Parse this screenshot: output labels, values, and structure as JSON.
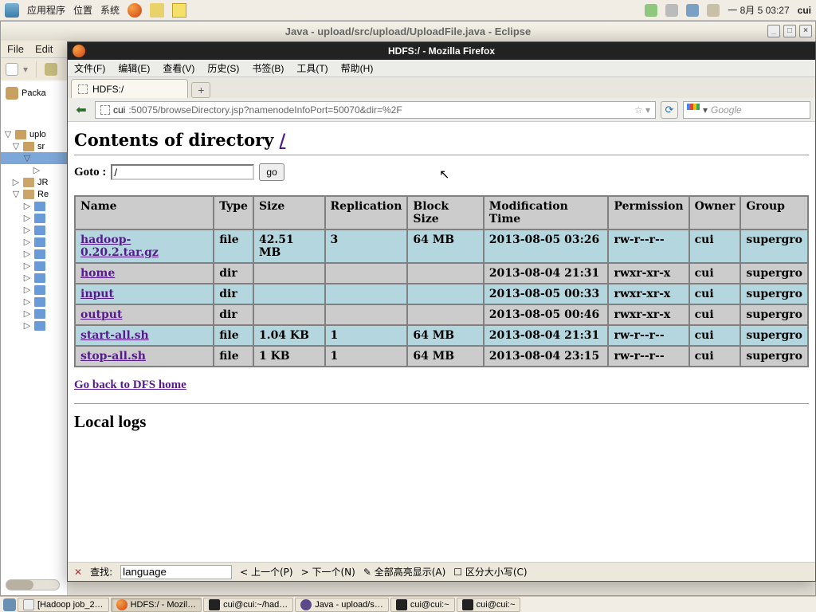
{
  "gnome": {
    "apps": "应用程序",
    "places": "位置",
    "system": "系统",
    "date": "一 8月  5 03:27",
    "user": "cui"
  },
  "eclipse": {
    "title": "Java - upload/src/upload/UploadFile.java - Eclipse",
    "menu_file": "File",
    "menu_edit": "Edit",
    "pkg_explorer": "Packa",
    "nodes": {
      "uplo": "uplo",
      "sr": "sr",
      "jr": "JR",
      "re": "Re"
    }
  },
  "firefox": {
    "title": "HDFS:/ - Mozilla Firefox",
    "menu": {
      "file": "文件(F)",
      "edit": "编辑(E)",
      "view": "查看(V)",
      "history": "历史(S)",
      "bookmarks": "书签(B)",
      "tools": "工具(T)",
      "help": "帮助(H)"
    },
    "tab": "HDFS:/",
    "url_host": "cui",
    "url_path": ":50075/browseDirectory.jsp?namenodeInfoPort=50070&dir=%2F",
    "search_placeholder": "Google"
  },
  "page": {
    "heading_pre": "Contents of directory ",
    "heading_link": "/",
    "goto_label": "Goto : ",
    "goto_value": "/",
    "go_btn": "go",
    "headers": {
      "name": "Name",
      "type": "Type",
      "size": "Size",
      "repl": "Replication",
      "bs": "Block Size",
      "mtime": "Modification Time",
      "perm": "Permission",
      "owner": "Owner",
      "group": "Group"
    },
    "rows": [
      {
        "cls": "filerow",
        "name": "hadoop-0.20.2.tar.gz",
        "type": "file",
        "size": "42.51 MB",
        "repl": "3",
        "bs": "64 MB",
        "mtime": "2013-08-05 03:26",
        "perm": "rw-r--r--",
        "owner": "cui",
        "group": "supergro"
      },
      {
        "cls": "",
        "name": "home",
        "type": "dir",
        "size": "",
        "repl": "",
        "bs": "",
        "mtime": "2013-08-04 21:31",
        "perm": "rwxr-xr-x",
        "owner": "cui",
        "group": "supergro"
      },
      {
        "cls": "filerow",
        "name": "input",
        "type": "dir",
        "size": "",
        "repl": "",
        "bs": "",
        "mtime": "2013-08-05 00:33",
        "perm": "rwxr-xr-x",
        "owner": "cui",
        "group": "supergro"
      },
      {
        "cls": "",
        "name": "output",
        "type": "dir",
        "size": "",
        "repl": "",
        "bs": "",
        "mtime": "2013-08-05 00:46",
        "perm": "rwxr-xr-x",
        "owner": "cui",
        "group": "supergro"
      },
      {
        "cls": "filerow",
        "name": "start-all.sh",
        "type": "file",
        "size": "1.04 KB",
        "repl": "1",
        "bs": "64 MB",
        "mtime": "2013-08-04 21:31",
        "perm": "rw-r--r--",
        "owner": "cui",
        "group": "supergro"
      },
      {
        "cls": "",
        "name": "stop-all.sh",
        "type": "file",
        "size": "1 KB",
        "repl": "1",
        "bs": "64 MB",
        "mtime": "2013-08-04 23:15",
        "perm": "rw-r--r--",
        "owner": "cui",
        "group": "supergro"
      }
    ],
    "back_link": "Go back to DFS home",
    "local_logs": "Local logs"
  },
  "findbar": {
    "label": "查找:",
    "value": "language",
    "prev": "< 上一个(P)",
    "next": "> 下一个(N)",
    "highlight": "全部高亮显示(A)",
    "matchcase": "区分大小写(C)"
  },
  "taskbar": {
    "t1": "[Hadoop job_2…",
    "t2": "HDFS:/ - Mozil…",
    "t3": "cui@cui:~/had…",
    "t4": "Java - upload/s…",
    "t5": "cui@cui:~",
    "t6": "cui@cui:~"
  }
}
